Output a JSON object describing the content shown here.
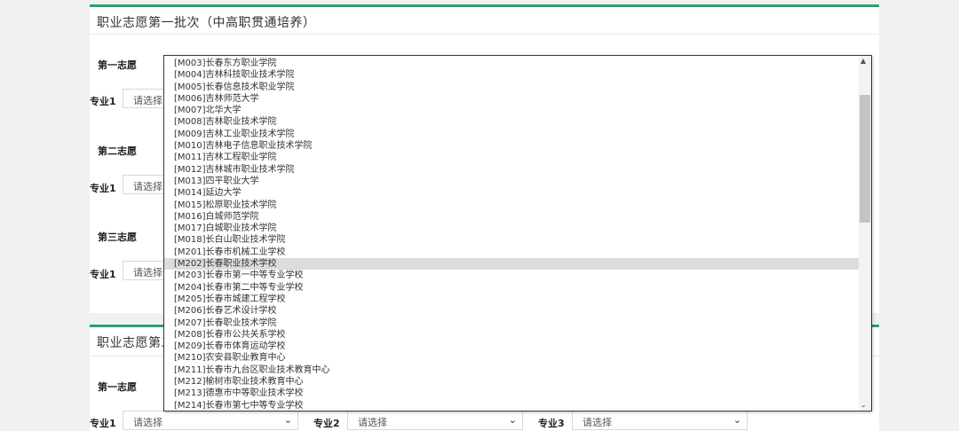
{
  "section1": {
    "title": "职业志愿第一批次（中高职贯通培养）",
    "first_choice_label": "第一志愿",
    "second_choice_label": "第二志愿",
    "third_choice_label": "第三志愿",
    "major1_label": "专业1",
    "select_placeholder": "请选择"
  },
  "section2": {
    "title": "职业志愿第二批次",
    "first_choice_label": "第一志愿",
    "major1_label": "专业1",
    "major2_label": "专业2",
    "major3_label": "专业3",
    "major1_value": "请选择",
    "major2_value": "请选择",
    "major3_value": "请选择"
  },
  "dropdown": {
    "options": [
      "[M003]长春东方职业学院",
      "[M004]吉林科技职业技术学院",
      "[M005]长春信息技术职业学院",
      "[M006]吉林师范大学",
      "[M007]北华大学",
      "[M008]吉林职业技术学院",
      "[M009]吉林工业职业技术学院",
      "[M010]吉林电子信息职业技术学院",
      "[M011]吉林工程职业学院",
      "[M012]吉林城市职业技术学院",
      "[M013]四平职业大学",
      "[M014]延边大学",
      "[M015]松原职业技术学院",
      "[M016]白城师范学院",
      "[M017]白城职业技术学院",
      "[M018]长白山职业技术学院",
      "[M201]长春市机械工业学校",
      "[M202]长春职业技术学校",
      "[M203]长春市第一中等专业学校",
      "[M204]长春市第二中等专业学校",
      "[M205]长春市城建工程学校",
      "[M206]长春艺术设计学校",
      "[M207]长春职业技术学院",
      "[M208]长春市公共关系学校",
      "[M209]长春市体育运动学校",
      "[M210]农安县职业教育中心",
      "[M211]长春市九台区职业技术教育中心",
      "[M212]榆树市职业技术教育中心",
      "[M213]德惠市中等职业技术学校",
      "[M214]长春市第七中等专业学校"
    ],
    "selected_index": 17,
    "scroll_position": 0.12
  },
  "colors": {
    "accent": "#2e9e6b",
    "selected_bg": "#dcdcdc"
  },
  "icons": {
    "chevron": "chevron-down-icon",
    "scroll_up": "scroll-up-arrow-icon",
    "scroll_down": "scroll-down-arrow-icon"
  }
}
